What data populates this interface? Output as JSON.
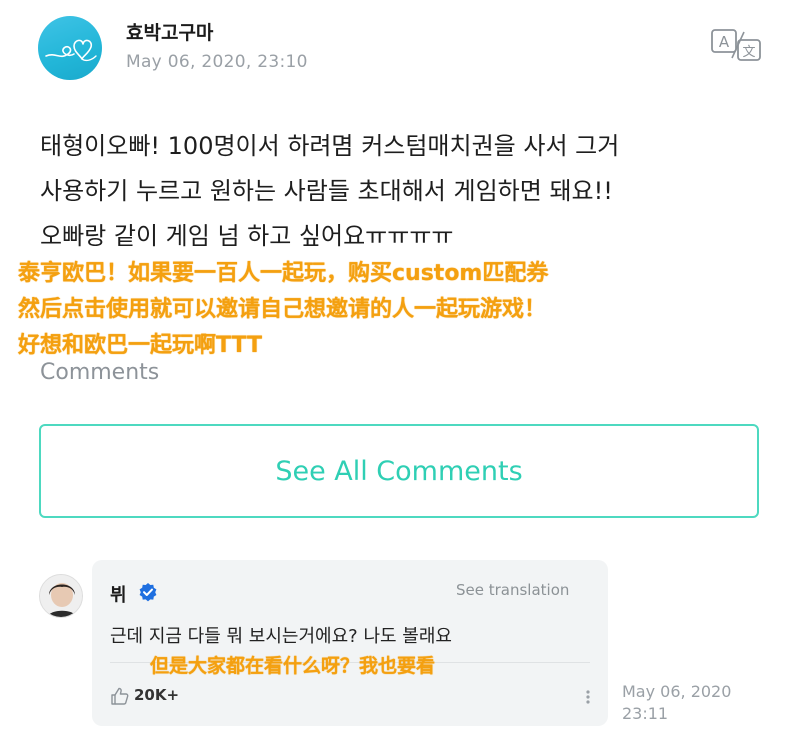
{
  "post": {
    "author": "효박고구마",
    "date": "May 06, 2020, 23:10",
    "body_lines": [
      "태형이오빠! 100명이서 하려몀 커스텀매치권을 사서 그거",
      "사용하기 누르고 원하는 사람들 초대해서 게임하면 돼요!!",
      "오빠랑 같이 게임 넘 하고 싶어요ㅠㅠㅠㅠ"
    ],
    "translation_overlay_lines": [
      "泰亨欧巴！如果要一百人一起玩，购买custom匹配券",
      "然后点击使用就可以邀请自己想邀请的人一起玩游戏！",
      "好想和欧巴一起玩啊TTT"
    ],
    "translate_icon": "translate-icon"
  },
  "comments": {
    "label": "Comments",
    "see_all_label": "See All Comments"
  },
  "reply": {
    "author": "뷔",
    "verified_icon": "verified-badge-icon",
    "see_translation": "See translation",
    "text": "근데 지금 다들 뭐 보시는거에요? 나도 볼래요",
    "translation_overlay": "但是大家都在看什么呀？我也要看",
    "likes": "20K+",
    "date_line1": "May 06, 2020",
    "date_line2": "23:11"
  },
  "colors": {
    "accent": "#2fcfb4",
    "overlay": "#f4a010",
    "verified": "#1f6fe0",
    "muted": "#9aa0a6"
  }
}
